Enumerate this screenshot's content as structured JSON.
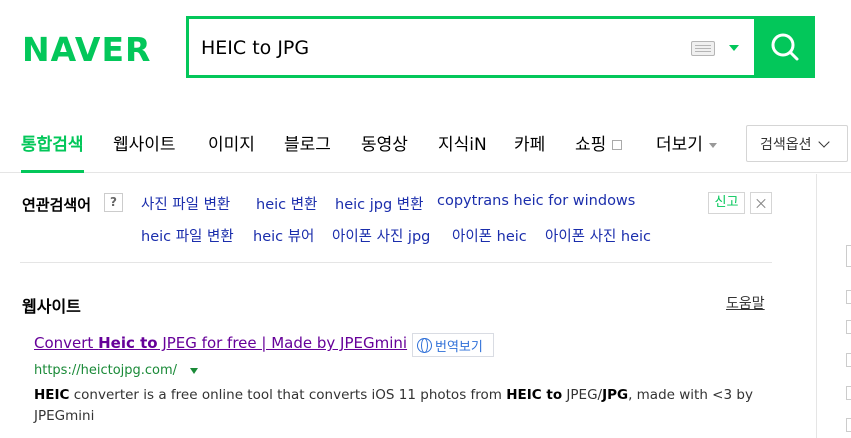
{
  "logo": "NAVER",
  "search": {
    "value": "HEIC to JPG"
  },
  "tabs": [
    "통합검색",
    "웹사이트",
    "이미지",
    "블로그",
    "동영상",
    "지식iN",
    "카페",
    "쇼핑",
    "더보기"
  ],
  "search_options": "검색옵션",
  "related": {
    "title": "연관검색어",
    "help": "?",
    "row1": [
      "사진 파일 변환",
      "heic 변환",
      "heic jpg 변환",
      "copytrans heic for windows"
    ],
    "row2": [
      "heic 파일 변환",
      "heic 뷰어",
      "아이폰 사진 jpg",
      "아이폰 heic",
      "아이폰 사진 heic"
    ],
    "report": "신고"
  },
  "section": {
    "title": "웹사이트",
    "help_link": "도움말"
  },
  "result": {
    "title_pre": "Convert ",
    "title_bold": "Heic to",
    "title_post": " JPEG for free  | Made by JPEGmini",
    "translate": "번역보기",
    "url": "https://heictojpg.com/",
    "desc_1": "HEIC",
    "desc_2": " converter is a free online tool that converts iOS 11 photos from ",
    "desc_3": "HEIC to",
    "desc_4": " JPEG/",
    "desc_5": "JPG",
    "desc_6": ", made with <3 by JPEGmini"
  },
  "colors": {
    "brand": "#03c75a",
    "link": "#1b2eac",
    "visited": "#660099",
    "url": "#1a8a38"
  }
}
